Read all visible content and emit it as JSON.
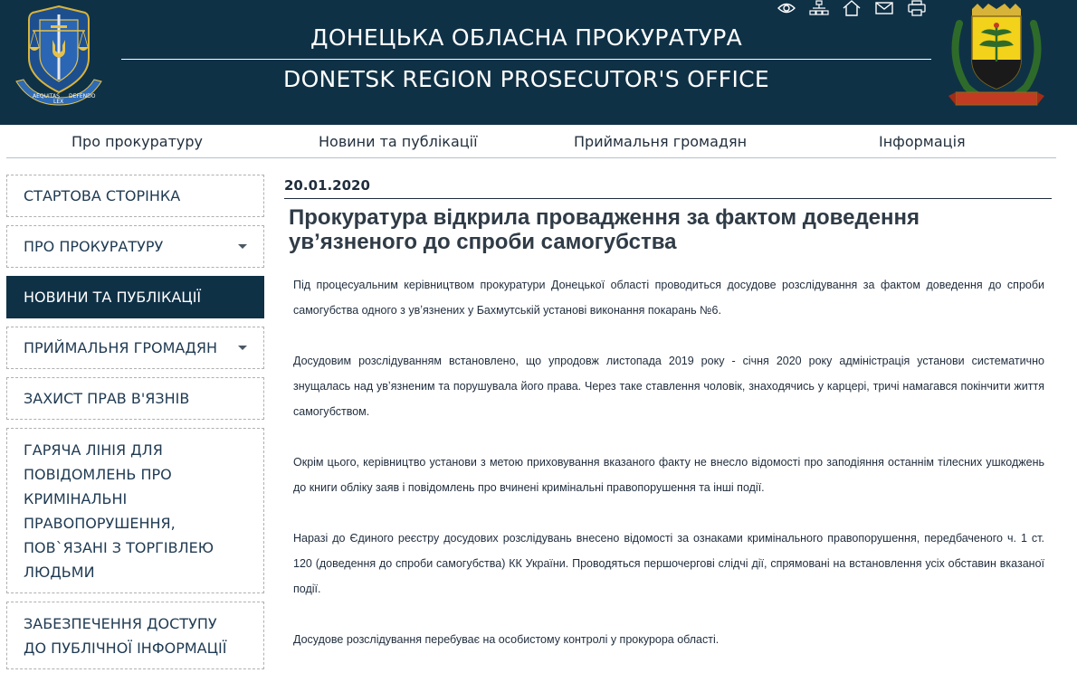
{
  "header": {
    "title_ua": "ДОНЕЦЬКА ОБЛАСНА ПРОКУРАТУРА",
    "title_en": "DONETSK REGION PROSECUTOR'S OFFICE",
    "left_emblem_motto": [
      "AEQUITAS",
      "LEX",
      "DEFENDO"
    ],
    "tools": [
      {
        "icon": "eye-icon"
      },
      {
        "icon": "sitemap-icon"
      },
      {
        "icon": "home-icon"
      },
      {
        "icon": "mail-icon"
      },
      {
        "icon": "print-icon"
      }
    ],
    "colors": {
      "background": "#0f3146",
      "text": "#ffffff"
    }
  },
  "topnav": {
    "items": [
      {
        "label": "Про прокуратуру"
      },
      {
        "label": "Новини та публікації"
      },
      {
        "label": "Приймальня громадян"
      },
      {
        "label": "Інформація"
      }
    ]
  },
  "sidebar": {
    "items": [
      {
        "label": "СТАРТОВА СТОРІНКА"
      },
      {
        "label": "ПРО ПРОКУРАТУРУ",
        "has_submenu": true
      },
      {
        "label": "НОВИНИ ТА ПУБЛІКАЦІЇ",
        "active": true
      },
      {
        "label": "ПРИЙМАЛЬНЯ ГРОМАДЯН",
        "has_submenu": true
      },
      {
        "label": "ЗАХИСТ ПРАВ В'ЯЗНІВ"
      },
      {
        "label": "ГАРЯЧА ЛІНІЯ ДЛЯ ПОВІДОМЛЕНЬ ПРО КРИМІНАЛЬНІ ПРАВОПОРУШЕННЯ, ПОВ`ЯЗАНІ З ТОРГІВЛЕЮ ЛЮДЬМИ"
      },
      {
        "label": "ЗАБЕЗПЕЧЕННЯ ДОСТУПУ ДО ПУБЛІЧНОЇ ІНФОРМАЦІЇ"
      }
    ],
    "colors": {
      "active_bg": "#0f3146",
      "active_text": "#ffffff"
    }
  },
  "article": {
    "date": "20.01.2020",
    "title": "Прокуратура відкрила провадження за фактом доведення увʼязненого до спроби самогубства",
    "paragraphs": [
      "Під процесуальним керівництвом прокуратури Донецької області проводиться досудове розслідування за фактом доведення до спроби самогубства одного з увʼязнених у Бахмутській установі виконання покарань №6.",
      "Досудовим розслідуванням встановлено, що упродовж листопада 2019 року - січня 2020 року адміністрація установи систематично знущалась над увʼязненим та порушувала його права. Через таке ставлення чоловік, знаходячись у карцері, тричі намагався покінчити життя самогубством.",
      "Окрім цього, керівництво установи з метою приховування вказаного факту не внесло відомості про заподіяння останнім тілесних ушкоджень до книги обліку заяв і повідомлень про вчинені кримінальні правопорушення та інші події.",
      "Наразі до Єдиного реєстру досудових розслідувань внесено відомості за ознаками кримінального правопорушення, передбаченого ч. 1 ст. 120 (доведення до спроби самогубства) КК України. Проводяться першочергові слідчі дії, спрямовані на встановлення усіх обставин вказаної події.",
      "Досудове розслідування перебуває на особистому контролі у прокурора області."
    ]
  }
}
